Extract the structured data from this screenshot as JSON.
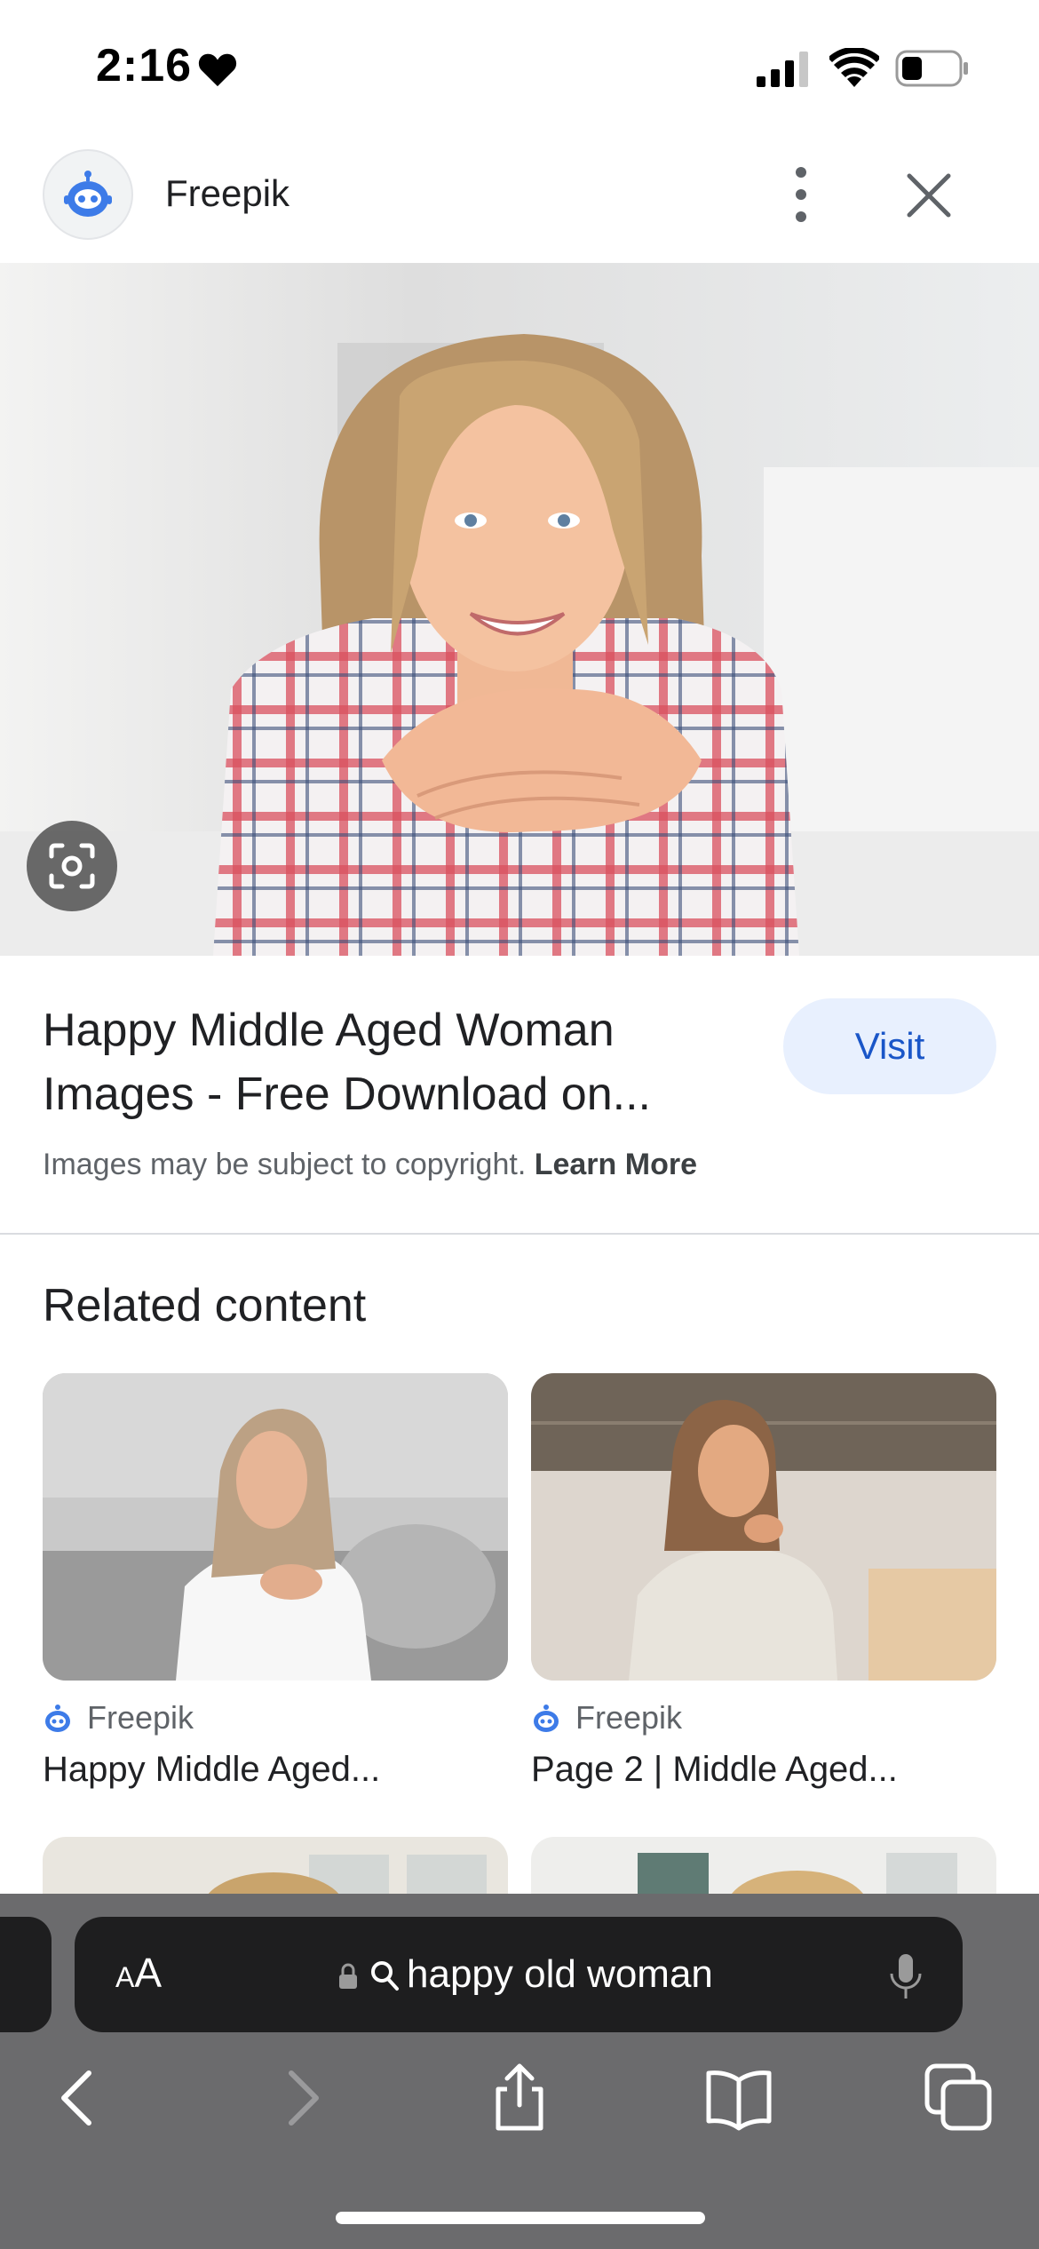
{
  "status_bar": {
    "time": "2:16"
  },
  "header": {
    "site_name": "Freepik"
  },
  "result": {
    "title": "Happy Middle Aged Woman Images - Free Download on...",
    "visit_label": "Visit",
    "copyright_text": "Images may be subject to copyright.",
    "learn_more_label": "Learn More"
  },
  "related": {
    "heading": "Related content",
    "items": [
      {
        "source": "Freepik",
        "title": "Happy Middle Aged..."
      },
      {
        "source": "Freepik",
        "title": "Page 2 | Middle Aged..."
      }
    ]
  },
  "browser": {
    "text_size_label_small": "A",
    "text_size_label_large": "A",
    "search_query": "happy old woman"
  },
  "colors": {
    "accent": "#1a56c8",
    "visit_bg": "#e8f0fe",
    "chrome_bg": "#6b6b6d",
    "address_bg": "#1e1e1f",
    "freepik_blue": "#3d7be8"
  },
  "icons": [
    "heart-icon",
    "signal-icon",
    "wifi-icon",
    "battery-icon",
    "freepik-logo-icon",
    "more-vert-icon",
    "close-icon",
    "lens-icon",
    "lock-icon",
    "search-icon",
    "mic-icon",
    "back-icon",
    "forward-icon",
    "share-icon",
    "bookmarks-icon",
    "tabs-icon"
  ]
}
